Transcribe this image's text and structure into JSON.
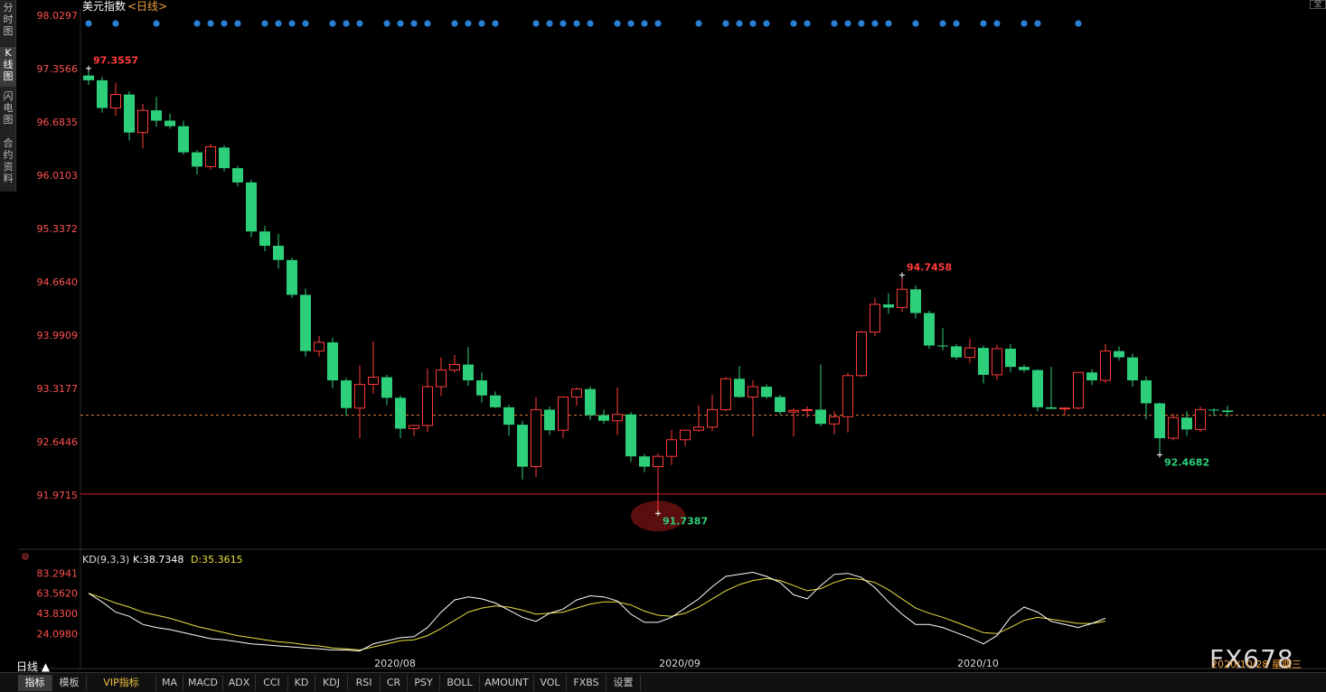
{
  "sidebar": {
    "tabs": [
      {
        "label": "分时图",
        "active": false
      },
      {
        "label": "K线图",
        "active": true
      },
      {
        "label": "闪电图",
        "active": false
      },
      {
        "label": "合约资料",
        "active": false
      }
    ]
  },
  "header": {
    "name": "美元指数",
    "period": "<日线>"
  },
  "top_right_btn": "全",
  "colors": {
    "up": "#ff3b3b",
    "down": "#2ecf7a",
    "axis_text": "#ff5050",
    "k_line": "#ffffff",
    "d_line": "#e8e040",
    "support_line": "#e02020",
    "current_line": "#e08040",
    "signal_dot": "#2a7fd4"
  },
  "main_chart": {
    "y_ticks": [
      "98.0297",
      "97.3566",
      "96.6835",
      "96.0103",
      "95.3372",
      "94.6640",
      "93.9909",
      "93.3177",
      "92.6446",
      "91.9715"
    ],
    "ylim": [
      91.9715,
      98.0297
    ],
    "support_level": 91.985,
    "current_level": 92.98,
    "annotations": [
      {
        "text": "97.3557",
        "type": "high"
      },
      {
        "text": "94.7458",
        "type": "high"
      },
      {
        "text": "91.7387",
        "type": "low"
      },
      {
        "text": "92.4682",
        "type": "low"
      }
    ],
    "x_labels": [
      "2020/08",
      "2020/09",
      "2020/10"
    ],
    "signal_dot_bars": [
      0,
      2,
      5,
      8,
      9,
      10,
      11,
      13,
      14,
      15,
      16,
      18,
      19,
      20,
      22,
      23,
      24,
      25,
      27,
      28,
      29,
      30,
      33,
      34,
      35,
      36,
      37,
      39,
      40,
      41,
      42,
      45,
      47,
      48,
      49,
      50,
      52,
      53,
      55,
      56,
      57,
      58,
      59,
      61,
      63,
      64,
      66,
      67,
      69,
      70,
      73
    ]
  },
  "chart_data": {
    "type": "candlestick",
    "ohlc": [
      [
        97.27,
        97.36,
        97.15,
        97.21
      ],
      [
        97.21,
        97.25,
        96.8,
        96.86
      ],
      [
        96.86,
        97.18,
        96.76,
        97.03
      ],
      [
        97.03,
        97.07,
        96.45,
        96.55
      ],
      [
        96.55,
        96.91,
        96.35,
        96.83
      ],
      [
        96.83,
        97.0,
        96.62,
        96.7
      ],
      [
        96.7,
        96.79,
        96.6,
        96.63
      ],
      [
        96.63,
        96.7,
        96.27,
        96.3
      ],
      [
        96.3,
        96.33,
        96.02,
        96.12
      ],
      [
        96.12,
        96.41,
        96.08,
        96.37
      ],
      [
        96.36,
        96.39,
        96.06,
        96.1
      ],
      [
        96.1,
        96.13,
        95.87,
        95.92
      ],
      [
        95.92,
        95.95,
        95.23,
        95.3
      ],
      [
        95.3,
        95.37,
        95.05,
        95.12
      ],
      [
        95.12,
        95.27,
        94.83,
        94.94
      ],
      [
        94.94,
        94.97,
        94.46,
        94.5
      ],
      [
        94.5,
        94.58,
        93.72,
        93.79
      ],
      [
        93.79,
        93.98,
        93.72,
        93.9
      ],
      [
        93.9,
        93.96,
        93.32,
        93.42
      ],
      [
        93.42,
        93.45,
        92.97,
        93.07
      ],
      [
        93.07,
        93.61,
        92.69,
        93.37
      ],
      [
        93.37,
        93.91,
        93.25,
        93.46
      ],
      [
        93.46,
        93.49,
        93.11,
        93.2
      ],
      [
        93.2,
        93.23,
        92.69,
        92.81
      ],
      [
        92.81,
        92.86,
        92.72,
        92.85
      ],
      [
        92.85,
        93.57,
        92.77,
        93.34
      ],
      [
        93.34,
        93.71,
        93.22,
        93.55
      ],
      [
        93.55,
        93.74,
        93.52,
        93.62
      ],
      [
        93.62,
        93.84,
        93.35,
        93.42
      ],
      [
        93.42,
        93.52,
        93.14,
        93.23
      ],
      [
        93.23,
        93.28,
        93.07,
        93.08
      ],
      [
        93.08,
        93.11,
        92.72,
        92.86
      ],
      [
        92.86,
        92.91,
        92.17,
        92.33
      ],
      [
        92.33,
        93.21,
        92.2,
        93.05
      ],
      [
        93.05,
        93.09,
        92.73,
        92.79
      ],
      [
        92.79,
        93.18,
        92.69,
        93.21
      ],
      [
        93.21,
        93.33,
        93.1,
        93.31
      ],
      [
        93.31,
        93.34,
        92.92,
        92.98
      ],
      [
        92.98,
        93.05,
        92.87,
        92.91
      ],
      [
        92.91,
        93.33,
        92.73,
        92.99
      ],
      [
        92.99,
        93.02,
        92.39,
        92.46
      ],
      [
        92.46,
        92.49,
        92.26,
        92.33
      ],
      [
        92.33,
        92.5,
        91.74,
        92.46
      ],
      [
        92.46,
        92.79,
        92.35,
        92.67
      ],
      [
        92.67,
        92.79,
        92.59,
        92.79
      ],
      [
        92.79,
        93.11,
        92.77,
        92.83
      ],
      [
        92.83,
        93.24,
        92.78,
        93.05
      ],
      [
        93.05,
        93.46,
        93.03,
        93.44
      ],
      [
        93.44,
        93.6,
        93.2,
        93.21
      ],
      [
        93.21,
        93.42,
        92.71,
        93.34
      ],
      [
        93.34,
        93.37,
        93.19,
        93.21
      ],
      [
        93.21,
        93.24,
        92.99,
        93.02
      ],
      [
        93.02,
        93.07,
        92.71,
        93.04
      ],
      [
        93.04,
        93.09,
        92.95,
        93.05
      ],
      [
        93.05,
        93.62,
        92.84,
        92.87
      ],
      [
        92.87,
        93.03,
        92.74,
        92.96
      ],
      [
        92.96,
        93.52,
        92.76,
        93.48
      ],
      [
        93.48,
        94.05,
        93.46,
        94.03
      ],
      [
        94.03,
        94.46,
        93.98,
        94.38
      ],
      [
        94.38,
        94.52,
        94.26,
        94.34
      ],
      [
        94.34,
        94.75,
        94.28,
        94.57
      ],
      [
        94.57,
        94.62,
        94.2,
        94.27
      ],
      [
        94.27,
        94.3,
        93.82,
        93.86
      ],
      [
        93.86,
        94.08,
        93.8,
        93.85
      ],
      [
        93.85,
        93.88,
        93.68,
        93.71
      ],
      [
        93.71,
        93.95,
        93.64,
        93.83
      ],
      [
        93.83,
        93.86,
        93.38,
        93.49
      ],
      [
        93.49,
        93.87,
        93.42,
        93.82
      ],
      [
        93.82,
        93.88,
        93.52,
        93.59
      ],
      [
        93.59,
        93.62,
        93.52,
        93.55
      ],
      [
        93.55,
        93.56,
        93.03,
        93.08
      ],
      [
        93.08,
        93.59,
        93.06,
        93.06
      ],
      [
        93.06,
        93.08,
        92.97,
        93.07
      ],
      [
        93.07,
        93.52,
        93.05,
        93.52
      ],
      [
        93.52,
        93.56,
        93.36,
        93.42
      ],
      [
        93.42,
        93.88,
        93.39,
        93.79
      ],
      [
        93.79,
        93.85,
        93.67,
        93.71
      ],
      [
        93.71,
        93.76,
        93.34,
        93.42
      ],
      [
        93.42,
        93.47,
        92.93,
        93.13
      ],
      [
        93.13,
        93.14,
        92.48,
        92.69
      ],
      [
        92.69,
        93.0,
        92.66,
        92.95
      ],
      [
        92.95,
        93.03,
        92.72,
        92.8
      ],
      [
        92.8,
        93.09,
        92.77,
        93.05
      ],
      [
        93.05,
        93.07,
        92.97,
        93.04
      ],
      [
        93.04,
        93.1,
        92.96,
        93.02
      ]
    ]
  },
  "indicator": {
    "name": "KD(9,3,3)",
    "k_label": "K:38.7348",
    "d_label": "D:35.3615",
    "y_ticks": [
      "83.2941",
      "63.5620",
      "43.8300",
      "24.0980"
    ],
    "ylim": [
      4.0,
      88.0
    ],
    "k_values": [
      63.5,
      55,
      45,
      41,
      33,
      30,
      28,
      25,
      22,
      19,
      18,
      16,
      14,
      13,
      12,
      11,
      10,
      9,
      8,
      8,
      7,
      14,
      17,
      20,
      21,
      30,
      45,
      57,
      60,
      58,
      54,
      47,
      40,
      36,
      44,
      48,
      57,
      61,
      60,
      56,
      43,
      35,
      35,
      40,
      49,
      58,
      70,
      80,
      82,
      84,
      80,
      74,
      62,
      58,
      71,
      82,
      83,
      79,
      69,
      55,
      43,
      33,
      33,
      30,
      25,
      20,
      14,
      22,
      40,
      50,
      45,
      36,
      33,
      30,
      34,
      39
    ],
    "d_values": [
      63.5,
      59,
      54,
      50,
      45,
      42,
      39,
      35,
      31,
      28,
      25,
      22,
      20,
      18,
      16,
      15,
      13,
      12,
      10,
      9,
      8,
      11,
      14,
      17,
      18,
      22,
      29,
      37,
      45,
      49,
      51,
      50,
      47,
      43,
      44,
      45,
      49,
      53,
      55,
      55,
      52,
      46,
      42,
      41,
      44,
      50,
      58,
      66,
      72,
      76,
      78,
      76,
      71,
      66,
      68,
      74,
      78,
      77,
      74,
      67,
      58,
      49,
      44,
      40,
      35,
      30,
      25,
      24,
      30,
      37,
      40,
      38,
      36,
      34,
      34,
      36
    ]
  },
  "period_button": "日线 ▲",
  "bottom_tabs": [
    {
      "label": "指标",
      "active": true
    },
    {
      "label": "模板",
      "active": false
    },
    {
      "label": "VIP指标",
      "active": false,
      "vip": true
    },
    {
      "label": "MA",
      "active": false
    },
    {
      "label": "MACD",
      "active": false
    },
    {
      "label": "ADX",
      "active": false
    },
    {
      "label": "CCI",
      "active": false
    },
    {
      "label": "KD",
      "active": false
    },
    {
      "label": "KDJ",
      "active": false
    },
    {
      "label": "RSI",
      "active": false
    },
    {
      "label": "CR",
      "active": false
    },
    {
      "label": "PSY",
      "active": false
    },
    {
      "label": "BOLL",
      "active": false
    },
    {
      "label": "AMOUNT",
      "active": false
    },
    {
      "label": "VOL",
      "active": false
    },
    {
      "label": "FXBS",
      "active": false
    },
    {
      "label": "设置",
      "active": false
    }
  ],
  "watermark": "FX678",
  "date_box": "2020/10/28 星期三"
}
